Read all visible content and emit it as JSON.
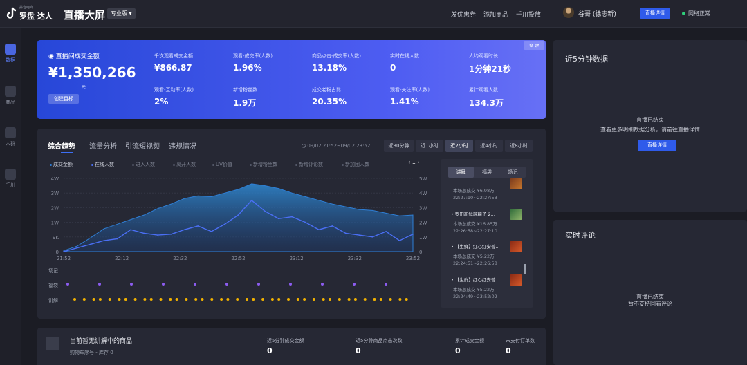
{
  "header": {
    "logo_small": "抖音电商",
    "logo_text": "罗盘 达人",
    "title": "直播大屏",
    "edition": "专业版",
    "nav": [
      "发优惠券",
      "添加商品",
      "千川投放"
    ],
    "user": "谷哥 (徐志新)",
    "detail_button": "直播详情",
    "network_status": "网络正常"
  },
  "sidebar": {
    "items": [
      {
        "label": "数据",
        "icon": "chart-icon"
      },
      {
        "label": "商品",
        "icon": "cart-icon"
      },
      {
        "label": "人群",
        "icon": "people-icon"
      },
      {
        "label": "千川",
        "icon": "ad-icon"
      }
    ]
  },
  "banner": {
    "gmv_label": "直播间成交金额",
    "gmv_value": "¥1,350,266",
    "gmv_unit": "元",
    "goal_button": "创建目标",
    "metrics": [
      {
        "label": "千次观看成交金额",
        "value": "¥866.87"
      },
      {
        "label": "观看-成交率(人数)",
        "value": "1.96%"
      },
      {
        "label": "商品点击-成交率(人数)",
        "value": "13.18%"
      },
      {
        "label": "实时在线人数",
        "value": "0"
      },
      {
        "label": "人均观看时长",
        "value": "1分钟21秒"
      },
      {
        "label": "观看-互动率(人数)",
        "value": "2%"
      },
      {
        "label": "新增粉丝数",
        "value": "1.9万"
      },
      {
        "label": "成交老粉占比",
        "value": "20.35%"
      },
      {
        "label": "观看-关注率(人数)",
        "value": "1.41%"
      },
      {
        "label": "累计观看人数",
        "value": "134.3万"
      }
    ]
  },
  "trend": {
    "tabs": [
      "综合趋势",
      "流量分析",
      "引流短视频",
      "违规情况"
    ],
    "time_range": "09/02 21:52~09/02 23:52",
    "range_buttons": [
      "近30分钟",
      "近1小时",
      "近2小时",
      "近4小时",
      "近8小时"
    ],
    "active_range": 2,
    "legend": [
      "成交金额",
      "在线人数",
      "进入人数",
      "离开人数",
      "UV价值",
      "新增粉丝数",
      "新增评论数",
      "新加团人数"
    ],
    "row_labels": [
      "场记",
      "福袋",
      "讲解"
    ],
    "pager": "‹ 1 ›"
  },
  "chart_data": {
    "type": "area",
    "x": [
      "21:52",
      "22:12",
      "22:32",
      "22:52",
      "23:12",
      "23:32",
      "23:52"
    ],
    "y_left_ticks": [
      "0",
      "9K",
      "1W",
      "2W",
      "3W",
      "4W"
    ],
    "y_right_ticks": [
      "0",
      "1W",
      "2W",
      "3W",
      "4W",
      "5W"
    ],
    "series": [
      {
        "name": "成交金额",
        "color": "#2f7fd6",
        "values": [
          500,
          3000,
          7500,
          12500,
          15000,
          17500,
          20000,
          23500,
          26000,
          29000,
          30500,
          30000,
          32000,
          34000,
          37000,
          36000,
          34500,
          32000,
          30000,
          28000,
          26000,
          24500,
          23000,
          22500,
          21000,
          19500,
          20000
        ]
      },
      {
        "name": "在线人数",
        "color": "#4b6ff5",
        "values": [
          0,
          2000,
          4000,
          6000,
          7000,
          12000,
          10000,
          9000,
          9500,
          12000,
          14000,
          11000,
          15000,
          20000,
          28000,
          22000,
          18000,
          19000,
          16000,
          12000,
          14000,
          10000,
          9000,
          8000,
          11000,
          6000,
          9500
        ]
      }
    ],
    "fudai_count": 11,
    "jiangjie_count": 40
  },
  "explain_list": {
    "tabs": [
      "讲解",
      "福袋",
      "场记"
    ],
    "items": [
      {
        "title": "",
        "gmv": "本场总成交 ¥6.98万",
        "time": "22:27:10~22:27:53"
      },
      {
        "title": "罗田新鲜粽粽子 2...",
        "gmv": "本场总成交 ¥16.85万",
        "time": "22:26:58~22:27:10"
      },
      {
        "title": "【生鲜】红心红安普...",
        "gmv": "本场总成交 ¥5.22万",
        "time": "22:24:51~22:26:58"
      },
      {
        "title": "【生鲜】红心红安普...",
        "gmv": "本场总成交 ¥5.22万",
        "time": "22:24:49~23:52:02"
      }
    ]
  },
  "bottom": {
    "title": "当前暂无讲解中的商品",
    "sub": "购物车序号 -    库存 0",
    "stats": [
      {
        "label": "近5分钟成交金额",
        "value": "0"
      },
      {
        "label": "近5分钟商品点击次数",
        "value": "0"
      },
      {
        "label": "累计成交金额",
        "value": "0"
      },
      {
        "label": "未支付订单数",
        "value": "0"
      }
    ]
  },
  "right_top": {
    "title": "近5分钟数据",
    "msg1": "直播已结束",
    "msg2": "查看更多明细数据分析，请前往直播详情",
    "button": "直播详情"
  },
  "right_bottom": {
    "title": "实时评论",
    "msg1": "直播已结束",
    "msg2": "暂不支持回看评论"
  }
}
